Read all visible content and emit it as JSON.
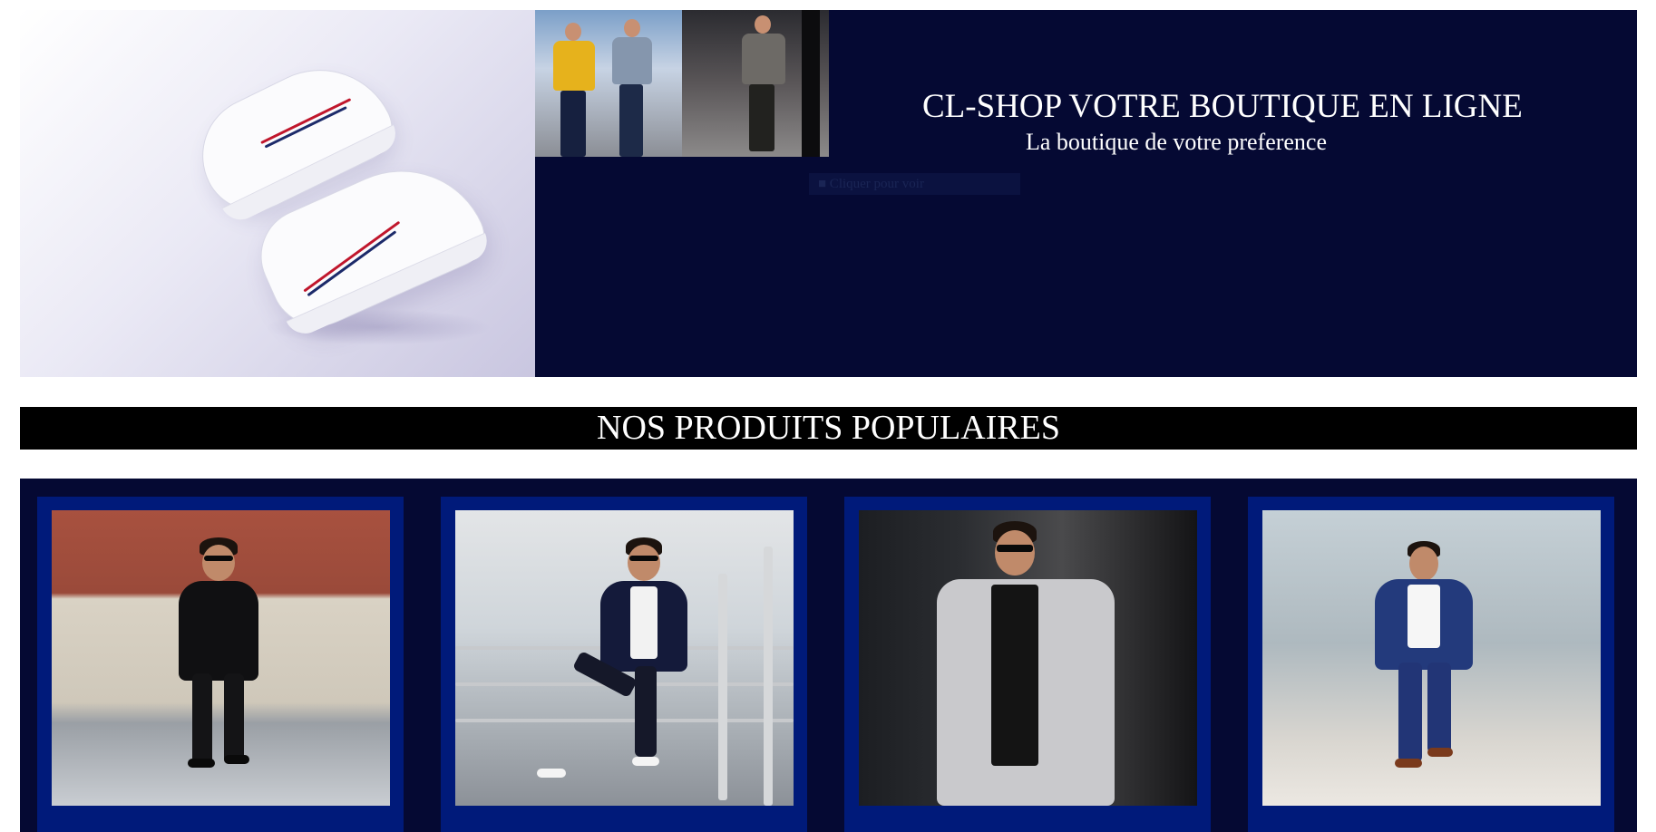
{
  "hero": {
    "title": "CL-SHOP VOTRE BOUTIQUE EN LIGNE",
    "subtitle": "La boutique de votre preference",
    "hint": "■ Cliquer pour voir",
    "colors": {
      "background": "#050933",
      "text": "#ffffff"
    },
    "images": [
      {
        "name": "sneakers-photo"
      },
      {
        "name": "street-style-photo"
      },
      {
        "name": "suit-man-photo"
      }
    ]
  },
  "section": {
    "title": "NOS PRODUITS POPULAIRES",
    "colors": {
      "background": "#000000",
      "text": "#ffffff"
    }
  },
  "products": {
    "colors": {
      "background": "#050933",
      "card": "#001a7a"
    },
    "items": [
      {
        "name": "black-suit"
      },
      {
        "name": "navy-blazer-white-tee"
      },
      {
        "name": "grey-coat-black-sweater"
      },
      {
        "name": "blue-suit"
      }
    ]
  }
}
